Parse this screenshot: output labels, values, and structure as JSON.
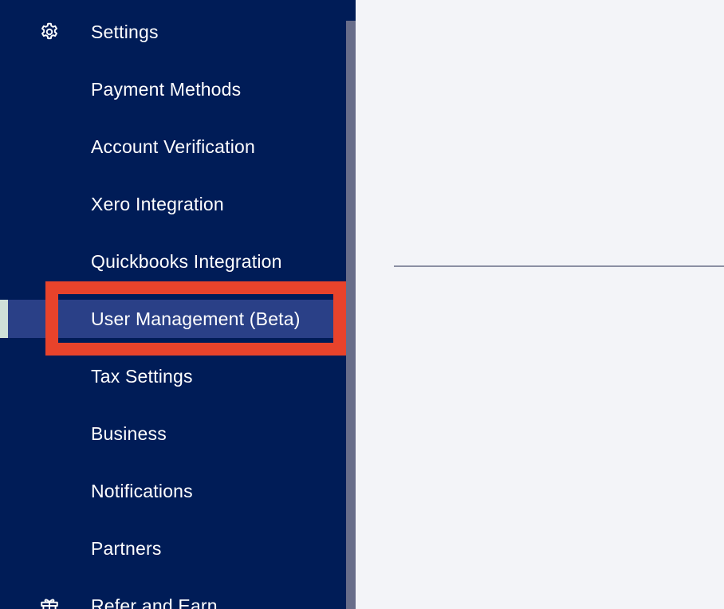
{
  "sidebar": {
    "settings": {
      "label": "Settings",
      "icon": "gear-icon"
    },
    "items": [
      {
        "label": "Payment Methods"
      },
      {
        "label": "Account Verification"
      },
      {
        "label": "Xero Integration"
      },
      {
        "label": "Quickbooks Integration"
      },
      {
        "label": "User Management (Beta)",
        "active": true
      },
      {
        "label": "Tax Settings"
      },
      {
        "label": "Business"
      },
      {
        "label": "Notifications"
      },
      {
        "label": "Partners"
      }
    ],
    "refer": {
      "label": "Refer and Earn",
      "icon": "gift-icon"
    }
  },
  "colors": {
    "sidebar_bg": "#001c57",
    "active_bg": "#2a4087",
    "highlight": "#e8432b",
    "content_bg": "#f3f4f8"
  }
}
